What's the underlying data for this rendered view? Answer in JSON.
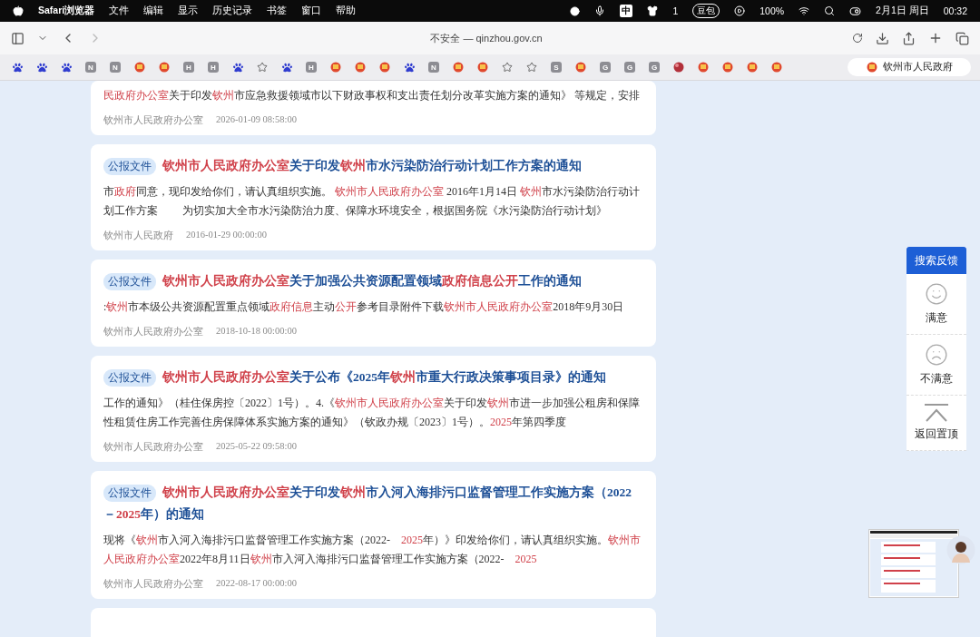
{
  "menubar": {
    "app": "Safari浏览器",
    "menus": [
      "文件",
      "编辑",
      "显示",
      "历史记录",
      "书签",
      "窗口",
      "帮助"
    ],
    "input_method": "中",
    "shirt_count": "1",
    "doubao": "豆包",
    "battery": "100%",
    "date": "2月1日 周日",
    "time": "00:32"
  },
  "toolbar": {
    "address": "不安全 — qinzhou.gov.cn"
  },
  "bookmarks": [
    {
      "kind": "paw"
    },
    {
      "kind": "paw"
    },
    {
      "kind": "paw"
    },
    {
      "kind": "letter",
      "letter": "N"
    },
    {
      "kind": "letter",
      "letter": "N"
    },
    {
      "kind": "emblem"
    },
    {
      "kind": "emblem"
    },
    {
      "kind": "letter",
      "letter": "H"
    },
    {
      "kind": "letter",
      "letter": "H"
    },
    {
      "kind": "paw"
    },
    {
      "kind": "star"
    },
    {
      "kind": "paw"
    },
    {
      "kind": "letter",
      "letter": "H"
    },
    {
      "kind": "emblem"
    },
    {
      "kind": "emblem"
    },
    {
      "kind": "emblem"
    },
    {
      "kind": "paw"
    },
    {
      "kind": "letter",
      "letter": "N"
    },
    {
      "kind": "emblem"
    },
    {
      "kind": "emblem"
    },
    {
      "kind": "star"
    },
    {
      "kind": "star"
    },
    {
      "kind": "letter",
      "letter": "S"
    },
    {
      "kind": "emblem"
    },
    {
      "kind": "letter",
      "letter": "G"
    },
    {
      "kind": "letter",
      "letter": "G"
    },
    {
      "kind": "letter",
      "letter": "G"
    },
    {
      "kind": "ball"
    },
    {
      "kind": "emblem"
    },
    {
      "kind": "emblem"
    },
    {
      "kind": "emblem"
    },
    {
      "kind": "emblem"
    }
  ],
  "pinned_tab": {
    "label": "钦州市人民政府"
  },
  "results": [
    {
      "summary": [
        {
          "text": "民政府办公室",
          "highlight": true
        },
        {
          "text": "关于印发",
          "highlight": false
        },
        {
          "text": "钦州",
          "highlight": true
        },
        {
          "text": "市应急救援领域市以下财政事权和支出责任划分改革实施方案的通知》 等规定，安排",
          "highlight": false
        }
      ],
      "source": "钦州市人民政府办公室",
      "date": "2026-01-09 08:58:00"
    },
    {
      "tag": "公报文件",
      "title": [
        {
          "text": "钦州市人民政府办公室",
          "highlight": true
        },
        {
          "text": "关于印发",
          "highlight": false
        },
        {
          "text": "钦州",
          "highlight": true
        },
        {
          "text": "市水污染防治行动计划工作方案的通知",
          "highlight": false
        }
      ],
      "summary": [
        {
          "text": "市",
          "highlight": false
        },
        {
          "text": "政府",
          "highlight": true
        },
        {
          "text": "同意，现印发给你们，请认真组织实施。 ",
          "highlight": false
        },
        {
          "text": "钦州市人民政府办公室",
          "highlight": true
        },
        {
          "text": " 2016年1月14日 ",
          "highlight": false
        },
        {
          "text": "钦州",
          "highlight": true
        },
        {
          "text": "市水污染防治行动计划工作方案　　 为切实加大全市水污染防治力度、保障水环境安全，根据国务院《水污染防治行动计划》",
          "highlight": false
        }
      ],
      "source": "钦州市人民政府",
      "date": "2016-01-29 00:00:00"
    },
    {
      "tag": "公报文件",
      "title": [
        {
          "text": "钦州市人民政府办公室",
          "highlight": true
        },
        {
          "text": "关于加强公共资源配置领域",
          "highlight": false
        },
        {
          "text": "政府信息公开",
          "highlight": true
        },
        {
          "text": "工作的通知",
          "highlight": false
        }
      ],
      "summary": [
        {
          "text": ":",
          "highlight": false
        },
        {
          "text": "钦州",
          "highlight": true
        },
        {
          "text": "市本级公共资源配置重点领域",
          "highlight": false
        },
        {
          "text": "政府信息",
          "highlight": true
        },
        {
          "text": "主动",
          "highlight": false
        },
        {
          "text": "公开",
          "highlight": true
        },
        {
          "text": "参考目录附件下载",
          "highlight": false
        },
        {
          "text": "钦州市人民政府办公室",
          "highlight": true
        },
        {
          "text": "2018年9月30日",
          "highlight": false
        }
      ],
      "source": "钦州市人民政府办公室",
      "date": "2018-10-18 00:00:00"
    },
    {
      "tag": "公报文件",
      "title": [
        {
          "text": "钦州市人民政府办公室",
          "highlight": true
        },
        {
          "text": "关于公布《2025年",
          "highlight": false
        },
        {
          "text": "钦州",
          "highlight": true
        },
        {
          "text": "市重大行政决策事项目录》的通知",
          "highlight": false
        }
      ],
      "summary": [
        {
          "text": "工作的通知》（桂住保房控〔2022〕1号）。4.《",
          "highlight": false
        },
        {
          "text": "钦州市人民政府办公室",
          "highlight": true
        },
        {
          "text": "关于印发",
          "highlight": false
        },
        {
          "text": "钦州",
          "highlight": true
        },
        {
          "text": "市进一步加强公租房和保障性租赁住房工作完善住房保障体系实施方案的通知》（钦政办规〔2023〕1号）。",
          "highlight": false
        },
        {
          "text": "2025",
          "highlight": true
        },
        {
          "text": "年第四季度",
          "highlight": false
        }
      ],
      "source": "钦州市人民政府办公室",
      "date": "2025-05-22 09:58:00"
    },
    {
      "tag": "公报文件",
      "title": [
        {
          "text": "钦州市人民政府办公室",
          "highlight": true
        },
        {
          "text": "关于印发",
          "highlight": false
        },
        {
          "text": "钦州",
          "highlight": true
        },
        {
          "text": "市入河入海排污口监督管理工作实施方案（2022－",
          "highlight": false
        },
        {
          "text": "2025",
          "highlight": true
        },
        {
          "text": "年）的通知",
          "highlight": false
        }
      ],
      "summary": [
        {
          "text": "现将《",
          "highlight": false
        },
        {
          "text": "钦州",
          "highlight": true
        },
        {
          "text": "市入河入海排污口监督管理工作实施方案（2022-　",
          "highlight": false
        },
        {
          "text": "2025",
          "highlight": true
        },
        {
          "text": "年）》印发给你们，请认真组织实施。",
          "highlight": false
        },
        {
          "text": "钦州市人民政府办公室",
          "highlight": true
        },
        {
          "text": "2022年8月11日",
          "highlight": false
        },
        {
          "text": "钦州",
          "highlight": true
        },
        {
          "text": "市入河入海排污口监督管理工作实施方案（2022-　",
          "highlight": false
        },
        {
          "text": "2025",
          "highlight": true
        }
      ],
      "source": "钦州市人民政府办公室",
      "date": "2022-08-17 00:00:00"
    }
  ],
  "feedback": {
    "header": "搜索反馈",
    "items": [
      {
        "kind": "smile",
        "label": "满意"
      },
      {
        "kind": "frown",
        "label": "不满意"
      },
      {
        "kind": "top",
        "label": "返回置顶"
      }
    ]
  }
}
